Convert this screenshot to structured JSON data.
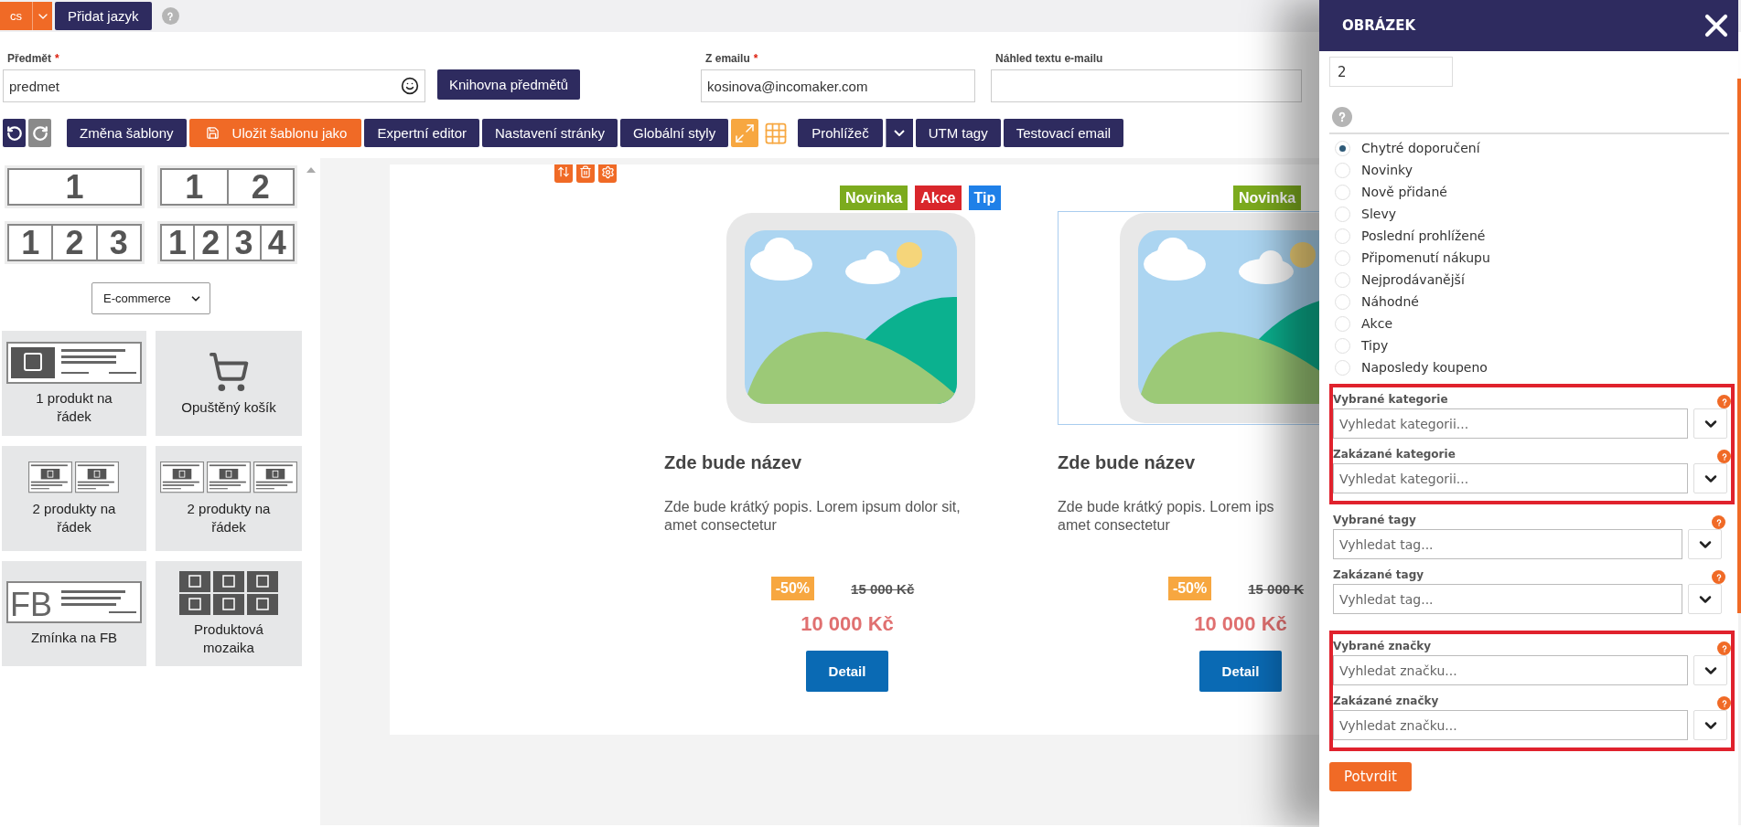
{
  "language_bar": {
    "language": "cs",
    "add_button": "Přidat jazyk"
  },
  "form": {
    "subject": {
      "label": "Předmět",
      "required_mark": "*",
      "value": "predmet"
    },
    "library_button": "Knihovna předmětů",
    "from_email": {
      "label": "Z emailu",
      "required_mark": "*",
      "value": "kosinova@incomaker.com"
    },
    "preview_text": {
      "label": "Náhled textu e-mailu"
    }
  },
  "toolbar": [
    {
      "kind": "undo"
    },
    {
      "kind": "redo"
    },
    {
      "kind": "button",
      "label": "Změna šablony"
    },
    {
      "kind": "save_button",
      "label": "Uložit šablonu jako"
    },
    {
      "kind": "button",
      "label": "Expertní editor"
    },
    {
      "kind": "button",
      "label": "Nastavení stránky"
    },
    {
      "kind": "button",
      "label": "Globální styly"
    },
    {
      "kind": "fullscreen"
    },
    {
      "kind": "grid"
    },
    {
      "kind": "dropdown",
      "label": "Prohlížeč"
    },
    {
      "kind": "button",
      "label": "UTM tagy"
    },
    {
      "kind": "button",
      "label": "Testovací email"
    }
  ],
  "layouts": [
    {
      "columns": [
        "1"
      ]
    },
    {
      "columns": [
        "1",
        "2"
      ]
    },
    {
      "columns": [
        "1",
        "2",
        "3"
      ]
    },
    {
      "columns": [
        "1",
        "2",
        "3",
        "4"
      ]
    }
  ],
  "block_category": "E-commerce",
  "blocks": [
    {
      "kind": "product_row",
      "label": "1 produkt na řádek"
    },
    {
      "kind": "cart",
      "label": "Opuštěný košík"
    },
    {
      "kind": "two_products",
      "label": "2 produkty na řádek"
    },
    {
      "kind": "three_products",
      "label": "2 produkty na řádek"
    },
    {
      "kind": "fb",
      "label": "Zmínka na FB",
      "icon_text": "FB"
    },
    {
      "kind": "mosaic",
      "label": "Produktová mozaika"
    }
  ],
  "products": [
    {
      "selected": false,
      "tags": [
        {
          "label": "Novinka",
          "color": "#7cab1e"
        },
        {
          "label": "Akce",
          "color": "#d9262b"
        },
        {
          "label": "Tip",
          "color": "#1f80e8"
        }
      ],
      "title": "Zde bude název",
      "description_lines": [
        "Zde bude krátký popis. Lorem ipsum dolor sit,",
        "amet consectetur"
      ],
      "discount": "-50%",
      "old_price": "15 000 Kč",
      "price": "10 000 Kč",
      "button": "Detail"
    },
    {
      "selected": true,
      "tags": [
        {
          "label": "Novinka",
          "color": "#7cab1e"
        }
      ],
      "title": "Zde bude název",
      "description_lines": [
        "Zde bude krátký popis. Lorem ips",
        "amet consectetur"
      ],
      "discount": "-50%",
      "old_price": "15 000 K",
      "price": "10 000 Kč",
      "button": "Detail"
    }
  ],
  "panel": {
    "title": "OBRÁZEK",
    "count_value": "2",
    "options": [
      {
        "label": "Chytré doporučení",
        "selected": true
      },
      {
        "label": "Novinky",
        "selected": false
      },
      {
        "label": "Nově přidané",
        "selected": false
      },
      {
        "label": "Slevy",
        "selected": false
      },
      {
        "label": "Poslední prohlížené",
        "selected": false
      },
      {
        "label": "Připomenutí nákupu",
        "selected": false
      },
      {
        "label": "Nejprodávanější",
        "selected": false
      },
      {
        "label": "Náhodné",
        "selected": false
      },
      {
        "label": "Akce",
        "selected": false
      },
      {
        "label": "Tipy",
        "selected": false
      },
      {
        "label": "Naposledy koupeno",
        "selected": false
      }
    ],
    "filter_groups": [
      {
        "kind": "highlighted",
        "fields": [
          {
            "label": "Vybrané kategorie",
            "placeholder": "Vyhledat kategorii..."
          },
          {
            "label": "Zakázané kategorie",
            "placeholder": "Vyhledat kategorii..."
          }
        ]
      },
      {
        "kind": "plain",
        "fields": [
          {
            "label": "Vybrané tagy",
            "placeholder": "Vyhledat tag..."
          },
          {
            "label": "Zakázané tagy",
            "placeholder": "Vyhledat tag..."
          }
        ]
      },
      {
        "kind": "highlighted",
        "fields": [
          {
            "label": "Vybrané značky",
            "placeholder": "Vyhledat značku..."
          },
          {
            "label": "Zakázané značky",
            "placeholder": "Vyhledat značku..."
          }
        ]
      }
    ],
    "confirm_button": "Potvrdit"
  }
}
